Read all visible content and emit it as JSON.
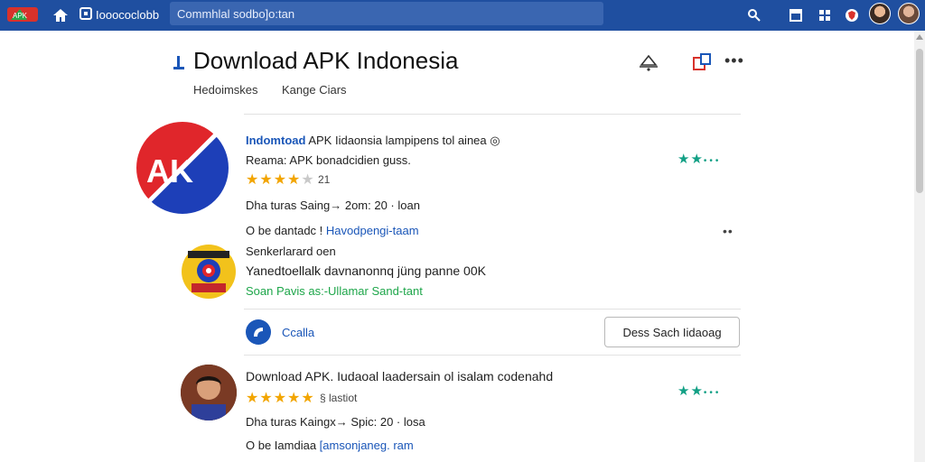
{
  "topbar": {
    "tab_title": "Iooococlobb",
    "search_value": "Commhlal sodbo]o:tan",
    "icons": [
      "logo-icon",
      "home-icon",
      "tab-icon",
      "search-tool-icon",
      "window-icon",
      "grid-icon",
      "shield-icon",
      "avatar",
      "avatar"
    ]
  },
  "header": {
    "title": "Download APK Indonesia",
    "subnav": [
      "Hedoimskes",
      "Kange Ciars"
    ]
  },
  "items": [
    {
      "prefix": "Indomtoad",
      "title": "APK Iidaonsia lampipens tol ainea ◎",
      "subtitle": "Reama:  APK bonadcidien guss.",
      "stars": 4,
      "rating_count": "21",
      "meta": "Dha turas Saing→  2om:  20 · loan",
      "link_prefix": "O be dantadc !",
      "link_text": "Havodpengi-taam"
    }
  ],
  "sub_item": {
    "caption": "Senkerlarard oen",
    "title": "Yanedtoellalk davnanonnq jüng panne 00K",
    "green_text": "Soan Pavis as:-Ullamar Sand-tant",
    "more_label": "••",
    "action_label": "Ccalla",
    "button_label": "Dess Sach Iidaoag"
  },
  "second_item": {
    "title": "Download APK. Iudaoal laadersain ol isalam codenahd",
    "stars": 5,
    "rating_extra": "§ lastiot",
    "meta": "Dha turas Kaingx→  Spic:  20 · losa",
    "link_prefix": "O be Iamdiaa",
    "link_text": "[amsonjaneg. ram"
  },
  "colors": {
    "topbar": "#1f4fa0",
    "link_blue": "#1a56b8",
    "green": "#1ea64a",
    "star": "#f2a500",
    "teal": "#12a085",
    "logo_red": "#e0262b",
    "logo_blue": "#1d3fb8"
  }
}
